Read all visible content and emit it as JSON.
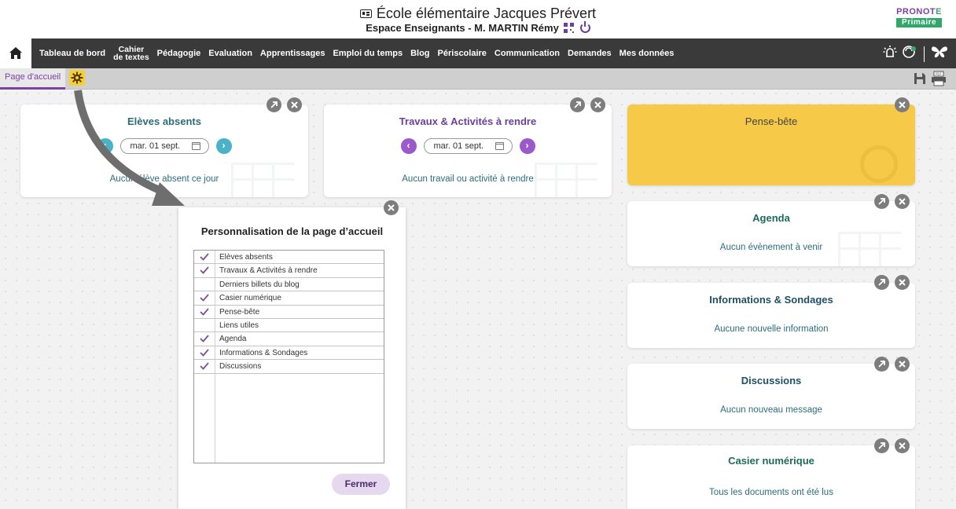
{
  "header": {
    "school_name": "École élémentaire Jacques Prévert",
    "space_label": "Espace Enseignants - M. MARTIN Rémy",
    "brand_top_a": "PRONOT",
    "brand_top_b": "E",
    "brand_bottom": "Primaire"
  },
  "navbar": {
    "items": [
      "Tableau de bord",
      "Cahier de textes",
      "Pédagogie",
      "Evaluation",
      "Apprentissages",
      "Emploi du temps",
      "Blog",
      "Périscolaire",
      "Communication",
      "Demandes",
      "Mes données"
    ],
    "cahier_line1": "Cahier",
    "cahier_line2": "de textes"
  },
  "tabbar": {
    "current_tab": "Page d'accueil"
  },
  "widgets": {
    "absents": {
      "title": "Elèves absents",
      "date": "mar. 01 sept.",
      "message": "Aucun élève absent ce jour",
      "nav_color": "#4ab2c6"
    },
    "travaux": {
      "title": "Travaux & Activités à rendre",
      "date": "mar. 01 sept.",
      "message": "Aucun travail ou activité à rendre",
      "nav_color": "#9b59c9"
    },
    "pense_bete": {
      "title": "Pense-bête",
      "bg_color": "#f7c948"
    },
    "agenda": {
      "title": "Agenda",
      "message": "Aucun évènement à venir"
    },
    "infos": {
      "title": "Informations & Sondages",
      "message": "Aucune nouvelle information"
    },
    "discussions": {
      "title": "Discussions",
      "message": "Aucun nouveau message"
    },
    "casier": {
      "title": "Casier numérique",
      "message": "Tous les documents ont été lus"
    }
  },
  "dialog": {
    "title": "Personnalisation de la page d’accueil",
    "items": [
      {
        "label": "Elèves absents",
        "checked": true
      },
      {
        "label": "Travaux & Activités à rendre",
        "checked": true
      },
      {
        "label": "Derniers billets du blog",
        "checked": false
      },
      {
        "label": "Casier numérique",
        "checked": true
      },
      {
        "label": "Pense-bête",
        "checked": true
      },
      {
        "label": "Liens utiles",
        "checked": false
      },
      {
        "label": "Agenda",
        "checked": true
      },
      {
        "label": "Informations & Sondages",
        "checked": true
      },
      {
        "label": "Discussions",
        "checked": true
      }
    ],
    "close_label": "Fermer"
  },
  "colors": {
    "accent_purple": "#7b3fa6",
    "title_teal": "#2c6c7a",
    "check_purple": "#7b4fa0"
  }
}
